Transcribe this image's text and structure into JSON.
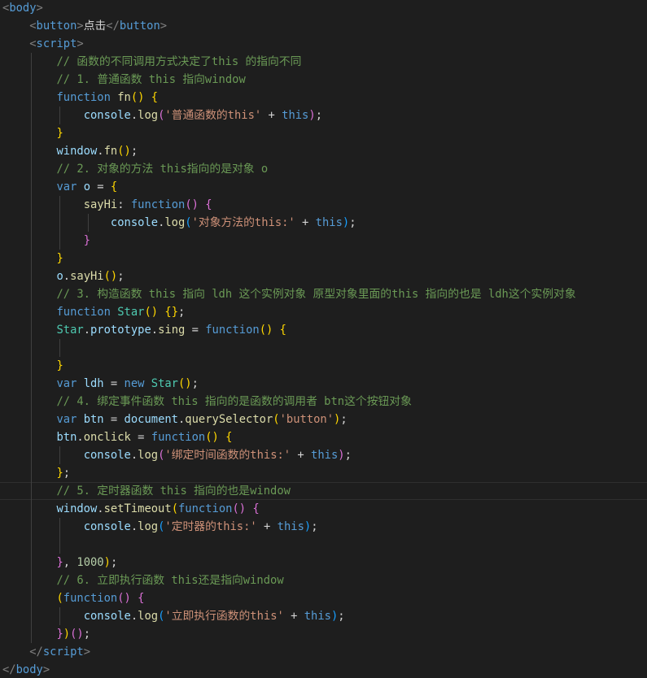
{
  "editor": {
    "language": "html",
    "theme": {
      "background": "#1e1e1e",
      "text": "#d4d4d4",
      "tag": "#569cd6",
      "comment": "#6a9955",
      "string": "#ce9178",
      "function": "#dcdcaa",
      "variable": "#9cdcfe",
      "class": "#4ec9b0",
      "number": "#b5cea8"
    },
    "current_line": 27,
    "lines": [
      {
        "indent": 0,
        "tokens": [
          [
            "br",
            "<"
          ],
          [
            "tag",
            "body"
          ],
          [
            "br",
            ">"
          ]
        ]
      },
      {
        "indent": 1,
        "tokens": [
          [
            "br",
            "<"
          ],
          [
            "tag",
            "button"
          ],
          [
            "br",
            ">"
          ],
          [
            "op",
            "点击"
          ],
          [
            "br",
            "</"
          ],
          [
            "tag",
            "button"
          ],
          [
            "br",
            ">"
          ]
        ]
      },
      {
        "indent": 1,
        "tokens": [
          [
            "br",
            "<"
          ],
          [
            "tag",
            "script"
          ],
          [
            "br",
            ">"
          ]
        ]
      },
      {
        "indent": 2,
        "tokens": [
          [
            "cm",
            "// 函数的不同调用方式决定了this 的指向不同"
          ]
        ]
      },
      {
        "indent": 2,
        "tokens": [
          [
            "cm",
            "// 1. 普通函数 this 指向window"
          ]
        ]
      },
      {
        "indent": 2,
        "tokens": [
          [
            "kw",
            "function"
          ],
          [
            "op",
            " "
          ],
          [
            "fn",
            "fn"
          ],
          [
            "p1",
            "()"
          ],
          [
            "op",
            " "
          ],
          [
            "p1",
            "{"
          ]
        ]
      },
      {
        "indent": 3,
        "tokens": [
          [
            "var",
            "console"
          ],
          [
            "op",
            "."
          ],
          [
            "fn",
            "log"
          ],
          [
            "p2",
            "("
          ],
          [
            "str",
            "'普通函数的this'"
          ],
          [
            "op",
            " + "
          ],
          [
            "kw",
            "this"
          ],
          [
            "p2",
            ")"
          ],
          [
            "op",
            ";"
          ]
        ]
      },
      {
        "indent": 2,
        "tokens": [
          [
            "p1",
            "}"
          ]
        ]
      },
      {
        "indent": 2,
        "tokens": [
          [
            "var",
            "window"
          ],
          [
            "op",
            "."
          ],
          [
            "fn",
            "fn"
          ],
          [
            "p1",
            "()"
          ],
          [
            "op",
            ";"
          ]
        ]
      },
      {
        "indent": 2,
        "tokens": [
          [
            "cm",
            "// 2. 对象的方法 this指向的是对象 o"
          ]
        ]
      },
      {
        "indent": 2,
        "tokens": [
          [
            "kw",
            "var"
          ],
          [
            "op",
            " "
          ],
          [
            "var",
            "o"
          ],
          [
            "op",
            " = "
          ],
          [
            "p1",
            "{"
          ]
        ]
      },
      {
        "indent": 3,
        "tokens": [
          [
            "fn",
            "sayHi"
          ],
          [
            "op",
            ": "
          ],
          [
            "kw",
            "function"
          ],
          [
            "p2",
            "()"
          ],
          [
            "op",
            " "
          ],
          [
            "p2",
            "{"
          ]
        ]
      },
      {
        "indent": 4,
        "tokens": [
          [
            "var",
            "console"
          ],
          [
            "op",
            "."
          ],
          [
            "fn",
            "log"
          ],
          [
            "p3",
            "("
          ],
          [
            "str",
            "'对象方法的this:'"
          ],
          [
            "op",
            " + "
          ],
          [
            "kw",
            "this"
          ],
          [
            "p3",
            ")"
          ],
          [
            "op",
            ";"
          ]
        ]
      },
      {
        "indent": 3,
        "tokens": [
          [
            "p2",
            "}"
          ]
        ]
      },
      {
        "indent": 2,
        "tokens": [
          [
            "p1",
            "}"
          ]
        ]
      },
      {
        "indent": 2,
        "tokens": [
          [
            "var",
            "o"
          ],
          [
            "op",
            "."
          ],
          [
            "fn",
            "sayHi"
          ],
          [
            "p1",
            "()"
          ],
          [
            "op",
            ";"
          ]
        ]
      },
      {
        "indent": 2,
        "tokens": [
          [
            "cm",
            "// 3. 构造函数 this 指向 ldh 这个实例对象 原型对象里面的this 指向的也是 ldh这个实例对象"
          ]
        ]
      },
      {
        "indent": 2,
        "tokens": [
          [
            "kw",
            "function"
          ],
          [
            "op",
            " "
          ],
          [
            "cls",
            "Star"
          ],
          [
            "p1",
            "()"
          ],
          [
            "op",
            " "
          ],
          [
            "p1",
            "{}"
          ],
          [
            "op",
            ";"
          ]
        ]
      },
      {
        "indent": 2,
        "tokens": [
          [
            "cls",
            "Star"
          ],
          [
            "op",
            "."
          ],
          [
            "var",
            "prototype"
          ],
          [
            "op",
            "."
          ],
          [
            "fn",
            "sing"
          ],
          [
            "op",
            " = "
          ],
          [
            "kw",
            "function"
          ],
          [
            "p1",
            "()"
          ],
          [
            "op",
            " "
          ],
          [
            "p1",
            "{"
          ]
        ]
      },
      {
        "indent": 3,
        "tokens": []
      },
      {
        "indent": 2,
        "tokens": [
          [
            "p1",
            "}"
          ]
        ]
      },
      {
        "indent": 2,
        "tokens": [
          [
            "kw",
            "var"
          ],
          [
            "op",
            " "
          ],
          [
            "var",
            "ldh"
          ],
          [
            "op",
            " = "
          ],
          [
            "kw",
            "new"
          ],
          [
            "op",
            " "
          ],
          [
            "cls",
            "Star"
          ],
          [
            "p1",
            "()"
          ],
          [
            "op",
            ";"
          ]
        ]
      },
      {
        "indent": 2,
        "tokens": [
          [
            "cm",
            "// 4. 绑定事件函数 this 指向的是函数的调用者 btn这个按钮对象"
          ]
        ]
      },
      {
        "indent": 2,
        "tokens": [
          [
            "kw",
            "var"
          ],
          [
            "op",
            " "
          ],
          [
            "var",
            "btn"
          ],
          [
            "op",
            " = "
          ],
          [
            "var",
            "document"
          ],
          [
            "op",
            "."
          ],
          [
            "fn",
            "querySelector"
          ],
          [
            "p1",
            "("
          ],
          [
            "str",
            "'button'"
          ],
          [
            "p1",
            ")"
          ],
          [
            "op",
            ";"
          ]
        ]
      },
      {
        "indent": 2,
        "tokens": [
          [
            "var",
            "btn"
          ],
          [
            "op",
            "."
          ],
          [
            "fn",
            "onclick"
          ],
          [
            "op",
            " = "
          ],
          [
            "kw",
            "function"
          ],
          [
            "p1",
            "()"
          ],
          [
            "op",
            " "
          ],
          [
            "p1",
            "{"
          ]
        ]
      },
      {
        "indent": 3,
        "tokens": [
          [
            "var",
            "console"
          ],
          [
            "op",
            "."
          ],
          [
            "fn",
            "log"
          ],
          [
            "p2",
            "("
          ],
          [
            "str",
            "'绑定时间函数的this:'"
          ],
          [
            "op",
            " + "
          ],
          [
            "kw",
            "this"
          ],
          [
            "p2",
            ")"
          ],
          [
            "op",
            ";"
          ]
        ]
      },
      {
        "indent": 2,
        "tokens": [
          [
            "p1",
            "}"
          ],
          [
            "op",
            ";"
          ]
        ]
      },
      {
        "indent": 2,
        "tokens": [
          [
            "cm",
            "// 5. 定时器函数 this 指向的也是window"
          ]
        ]
      },
      {
        "indent": 2,
        "tokens": [
          [
            "var",
            "window"
          ],
          [
            "op",
            "."
          ],
          [
            "fn",
            "setTimeout"
          ],
          [
            "p1",
            "("
          ],
          [
            "kw",
            "function"
          ],
          [
            "p2",
            "()"
          ],
          [
            "op",
            " "
          ],
          [
            "p2",
            "{"
          ]
        ]
      },
      {
        "indent": 3,
        "tokens": [
          [
            "var",
            "console"
          ],
          [
            "op",
            "."
          ],
          [
            "fn",
            "log"
          ],
          [
            "p3",
            "("
          ],
          [
            "str",
            "'定时器的this:'"
          ],
          [
            "op",
            " + "
          ],
          [
            "kw",
            "this"
          ],
          [
            "p3",
            ")"
          ],
          [
            "op",
            ";"
          ]
        ]
      },
      {
        "indent": 3,
        "tokens": []
      },
      {
        "indent": 2,
        "tokens": [
          [
            "p2",
            "}"
          ],
          [
            "op",
            ", "
          ],
          [
            "num",
            "1000"
          ],
          [
            "p1",
            ")"
          ],
          [
            "op",
            ";"
          ]
        ]
      },
      {
        "indent": 2,
        "tokens": [
          [
            "cm",
            "// 6. 立即执行函数 this还是指向window"
          ]
        ]
      },
      {
        "indent": 2,
        "tokens": [
          [
            "p1",
            "("
          ],
          [
            "kw",
            "function"
          ],
          [
            "p2",
            "()"
          ],
          [
            "op",
            " "
          ],
          [
            "p2",
            "{"
          ]
        ]
      },
      {
        "indent": 3,
        "tokens": [
          [
            "var",
            "console"
          ],
          [
            "op",
            "."
          ],
          [
            "fn",
            "log"
          ],
          [
            "p3",
            "("
          ],
          [
            "str",
            "'立即执行函数的this'"
          ],
          [
            "op",
            " + "
          ],
          [
            "kw",
            "this"
          ],
          [
            "p3",
            ")"
          ],
          [
            "op",
            ";"
          ]
        ]
      },
      {
        "indent": 2,
        "tokens": [
          [
            "p2",
            "}"
          ],
          [
            "p1",
            ")"
          ],
          [
            "p2",
            "()"
          ],
          [
            "op",
            ";"
          ]
        ]
      },
      {
        "indent": 1,
        "tokens": [
          [
            "br",
            "</"
          ],
          [
            "tag",
            "script"
          ],
          [
            "br",
            ">"
          ]
        ]
      },
      {
        "indent": 0,
        "tokens": [
          [
            "br",
            "</"
          ],
          [
            "tag",
            "body"
          ],
          [
            "br",
            ">"
          ]
        ]
      }
    ]
  }
}
